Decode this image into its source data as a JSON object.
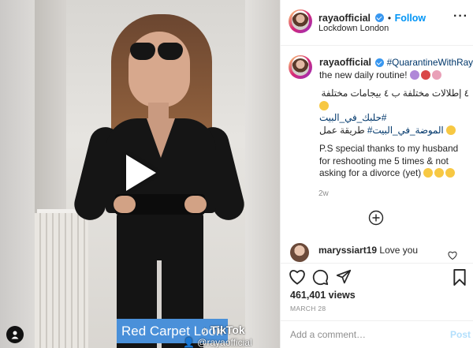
{
  "post": {
    "username": "rayaofficial",
    "follow_label": "Follow",
    "location": "Lockdown London",
    "caption": {
      "hashtag_main": "#QuarantineWithRaya",
      "line1": "the new daily routine!",
      "arabic_line": "٤ إطلالات مختلفة ب ٤ بيجامات مختلفة",
      "arabic_tag1": "#حلبك_في_البيت",
      "arabic_line2": "طريقة عمل",
      "arabic_tag2": "#الموضة_في_البيت",
      "ps_text": "P.S special thanks to my husband for reshooting me 5 times & not asking for a divorce (yet)"
    },
    "age": "2w",
    "reply": {
      "username": "maryssiart19",
      "text": "Love you"
    },
    "likes": "461,401 views",
    "date": "MARCH 28",
    "comment_placeholder": "Add a comment…",
    "post_button": "Post"
  },
  "video": {
    "caption_text": "Red Carpet Look",
    "tiktok_label": "TikTok",
    "tiktok_handle": "@rayaofficial"
  },
  "icons": {
    "more": "more-options-icon",
    "play": "play-icon",
    "user_tag": "user-tag-icon",
    "load_more": "plus-circle-icon",
    "like": "heart-icon",
    "comment": "comment-icon",
    "share": "share-icon",
    "save": "bookmark-icon"
  },
  "colors": {
    "accent": "#0095f6",
    "hashtag": "#00376b",
    "caption_bg": "#4a90d9"
  }
}
